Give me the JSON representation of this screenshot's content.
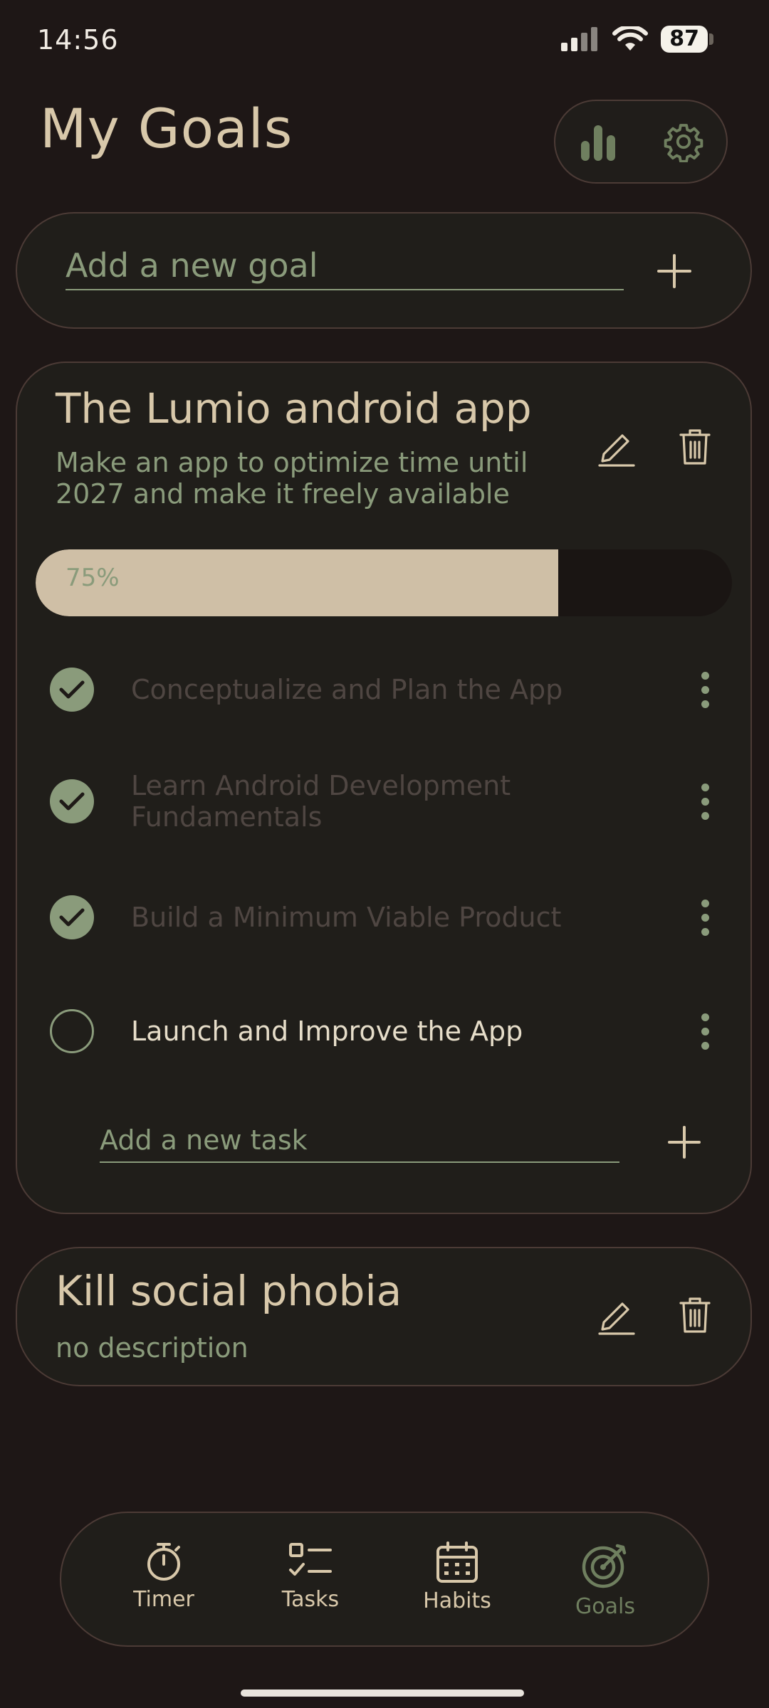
{
  "status_bar": {
    "time": "14:56",
    "battery": "87"
  },
  "header": {
    "title": "My Goals"
  },
  "new_goal": {
    "placeholder": "Add a new goal"
  },
  "goals": [
    {
      "title": "The Lumio android app",
      "description": "Make an app to optimize time until 2027 and make it freely available",
      "progress_label": "75%",
      "progress": 0.75,
      "tasks": [
        {
          "label": "Conceptualize and Plan the App",
          "done": true
        },
        {
          "label": "Learn Android Development Fundamentals",
          "done": true
        },
        {
          "label": "Build a Minimum Viable Product",
          "done": true
        },
        {
          "label": "Launch and Improve the App",
          "done": false
        }
      ],
      "new_task_placeholder": "Add a new task"
    },
    {
      "title": "Kill social phobia",
      "description": "no description"
    }
  ],
  "nav": {
    "items": [
      {
        "label": "Timer",
        "icon": "stopwatch-icon",
        "active": false
      },
      {
        "label": "Tasks",
        "icon": "checklist-icon",
        "active": false
      },
      {
        "label": "Habits",
        "icon": "calendar-icon",
        "active": false
      },
      {
        "label": "Goals",
        "icon": "target-icon",
        "active": true
      }
    ]
  },
  "colors": {
    "background": "#1e1716",
    "card": "#201e1a",
    "border": "#4c3b36",
    "accent_green": "#8a9b7b",
    "beige": "#d8c8aa"
  }
}
